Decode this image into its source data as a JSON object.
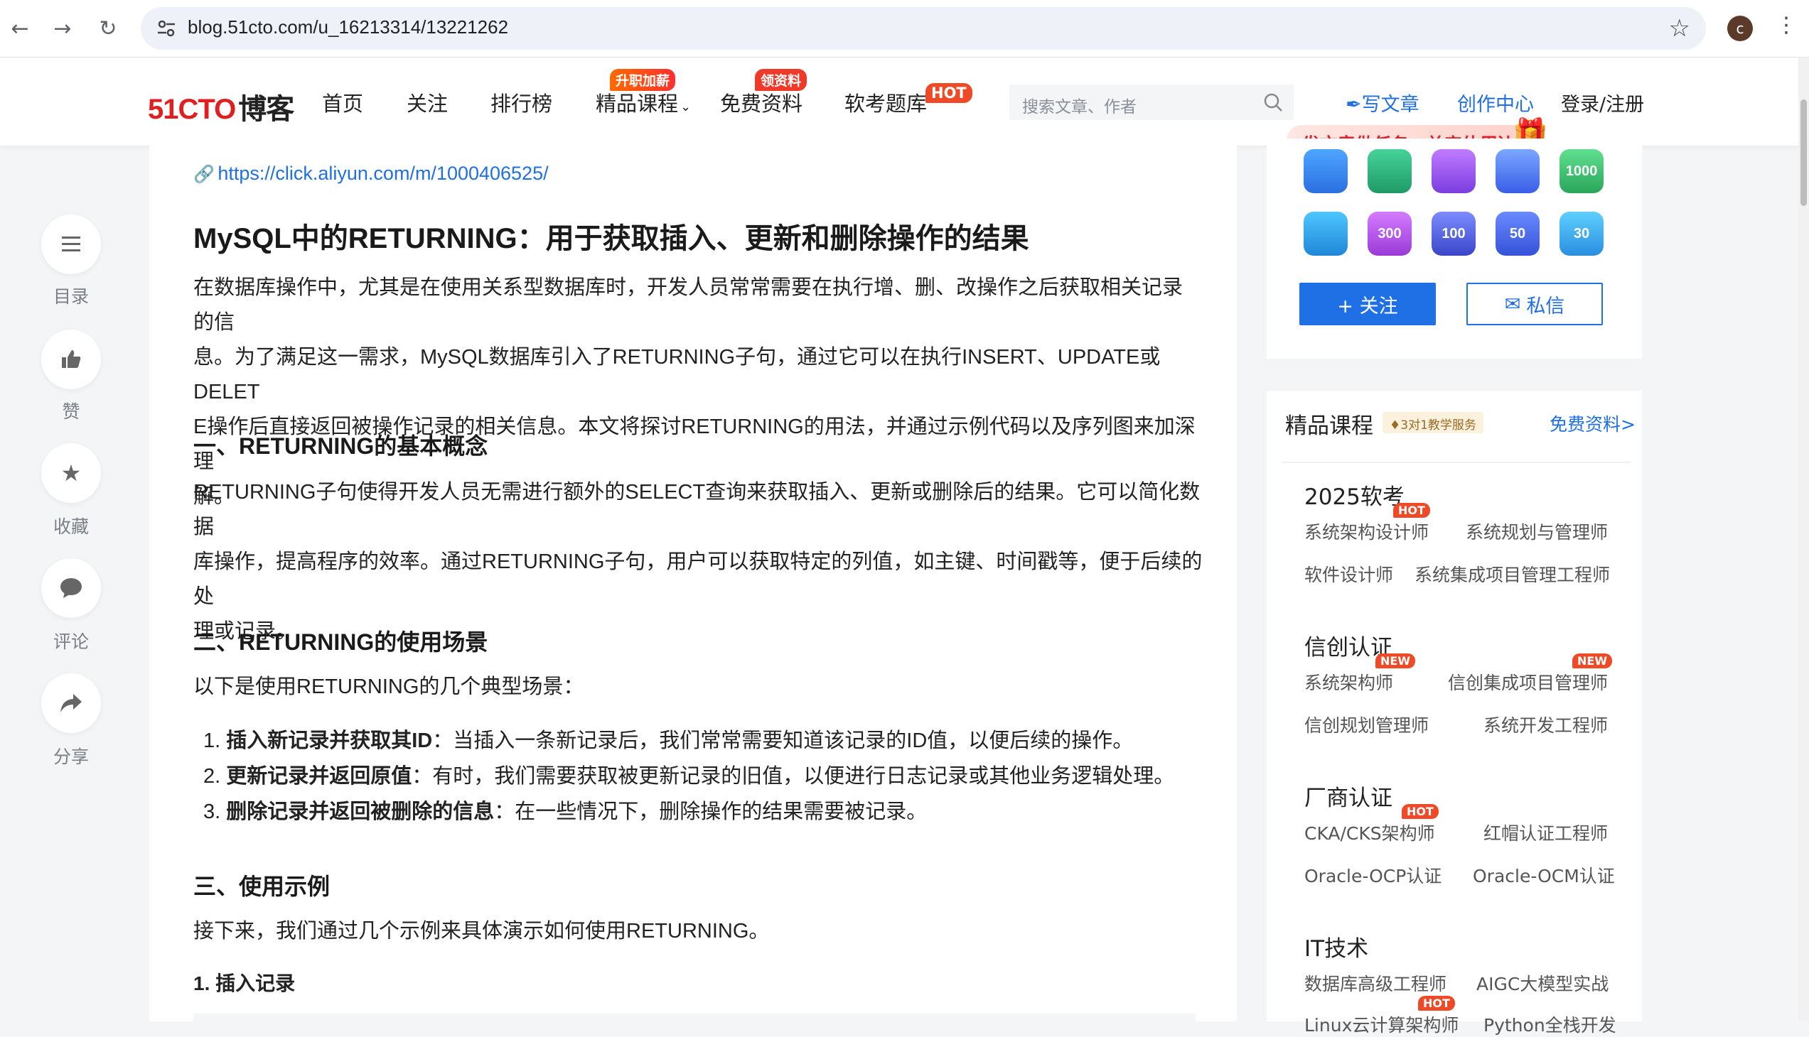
{
  "browser": {
    "url": "blog.51cto.com/u_16213314/13221262",
    "profile_initial": "c"
  },
  "header": {
    "logo_red": "51CTO",
    "logo_black": "博客",
    "nav": [
      "首页",
      "关注",
      "排行榜",
      "精品课程",
      "免费资料",
      "软考题库"
    ],
    "badges": {
      "courses": "升职加薪",
      "free": "领资料",
      "exam": "HOT"
    },
    "search_placeholder": "搜索文章、作者",
    "write": "写文章",
    "creation": "创作中心",
    "login": "登录/注册",
    "promo": "发文章做任务，兑实体周边"
  },
  "left_bar": {
    "toc": "目录",
    "like": "赞",
    "favorite": "收藏",
    "comment": "评论",
    "share": "分享"
  },
  "article": {
    "link": "https://click.aliyun.com/m/1000406525/",
    "title": "MySQL中的RETURNING：用于获取插入、更新和删除操作的结果",
    "intro_lines": [
      "在数据库操作中，尤其是在使用关系型数据库时，开发人员常常需要在执行增、删、改操作之后获取相关记录的信",
      "息。为了满足这一需求，MySQL数据库引入了RETURNING子句，通过它可以在执行INSERT、UPDATE或DELET",
      "E操作后直接返回被操作记录的相关信息。本文将探讨RETURNING的用法，并通过示例代码以及序列图来加深理",
      "解。"
    ],
    "h_concept": "一、RETURNING的基本概念",
    "concept_lines": [
      "RETURNING子句使得开发人员无需进行额外的SELECT查询来获取插入、更新或删除后的结果。它可以简化数据",
      "库操作，提高程序的效率。通过RETURNING子句，用户可以获取特定的列值，如主键、时间戳等，便于后续的处",
      "理或记录。"
    ],
    "h_scenarios": "二、RETURNING的使用场景",
    "scenarios_intro": "以下是使用RETURNING的几个典型场景：",
    "scenarios": [
      {
        "num": "1.",
        "bold": "插入新记录并获取其ID",
        "text": "：当插入一条新记录后，我们常常需要知道该记录的ID值，以便后续的操作。"
      },
      {
        "num": "2.",
        "bold": "更新记录并返回原值",
        "text": "：有时，我们需要获取被更新记录的旧值，以便进行日志记录或其他业务逻辑处理。"
      },
      {
        "num": "3.",
        "bold": "删除记录并返回被删除的信息",
        "text": "：在一些情况下，删除操作的结果需要被记录。"
      }
    ],
    "h_examples": "三、使用示例",
    "examples_intro": "接下来，我们通过几个示例来具体演示如何使用RETURNING。",
    "h_insert": "1. 插入记录"
  },
  "author_card": {
    "badges": [
      "",
      "",
      "",
      "",
      "1000",
      "",
      "300",
      "100",
      "50",
      "30"
    ],
    "follow": "+ 关注",
    "message": "私信"
  },
  "courses": {
    "title": "精品课程",
    "sub": "3对1教学服务",
    "free": "免费资料>",
    "groups": [
      {
        "name": "2025软考",
        "items": [
          "系统架构设计师",
          "系统规划与管理师",
          "软件设计师",
          "系统集成项目管理工程师"
        ]
      },
      {
        "name": "信创认证",
        "items": [
          "系统架构师",
          "信创集成项目管理师",
          "信创规划管理师",
          "系统开发工程师"
        ]
      },
      {
        "name": "厂商认证",
        "items": [
          "CKA/CKS架构师",
          "红帽认证工程师",
          "Oracle-OCP认证",
          "Oracle-OCM认证"
        ]
      },
      {
        "name": "IT技术",
        "items": [
          "数据库高级工程师",
          "AIGC大模型实战",
          "Linux云计算架构师",
          "Python全栈开发"
        ]
      }
    ],
    "tag_hot": "HOT",
    "tag_new": "NEW"
  }
}
